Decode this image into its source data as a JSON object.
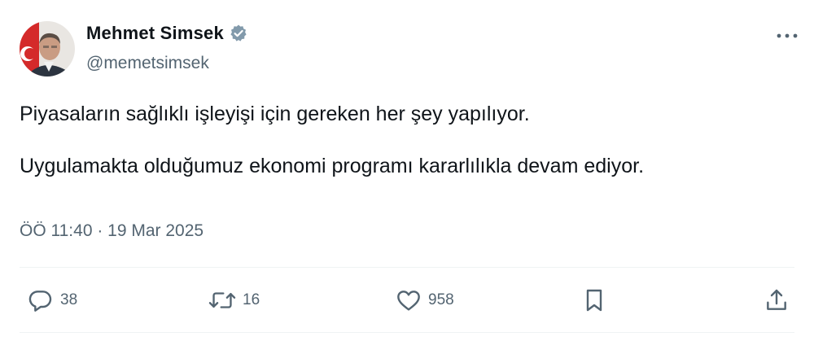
{
  "author": {
    "name": "Mehmet Simsek",
    "handle": "@memetsimsek",
    "verified": true,
    "avatar_icon": "profile-photo"
  },
  "tweet": {
    "paragraphs": [
      "Piyasaların sağlıklı işleyişi için gereken her şey yapılıyor.",
      "Uygulamakta olduğumuz ekonomi programı kararlılıkla devam ediyor."
    ],
    "timestamp": "ÖÖ 11:40 · 19 Mar 2025"
  },
  "actions": {
    "replies": "38",
    "reposts": "16",
    "likes": "958"
  },
  "icons": {
    "more": "more-icon",
    "reply": "reply-icon",
    "repost": "repost-icon",
    "like": "heart-icon",
    "bookmark": "bookmark-icon",
    "share": "share-icon",
    "verified": "verified-badge-icon"
  },
  "colors": {
    "text_primary": "#0f1419",
    "text_secondary": "#536471",
    "verified_badge": "#829aab",
    "divider": "#eff3f4"
  }
}
